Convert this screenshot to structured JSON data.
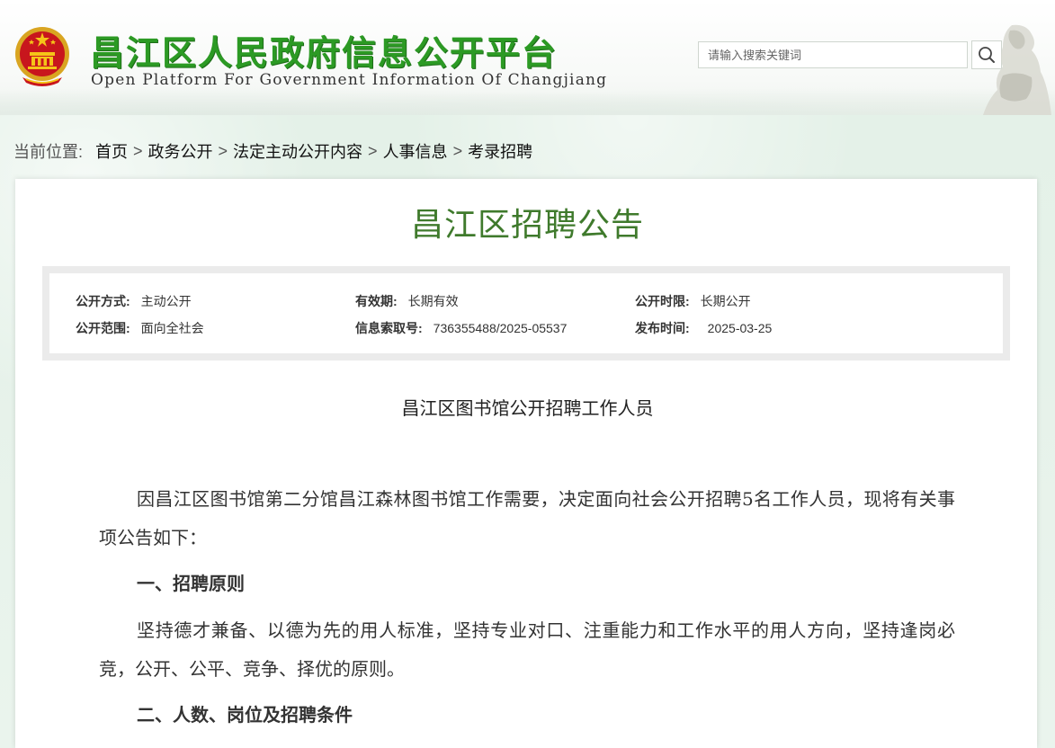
{
  "header": {
    "site_title": "昌江区人民政府信息公开平台",
    "site_subtitle": "Open Platform For Government Information Of Changjiang",
    "search": {
      "placeholder": "请输入搜索关键词"
    }
  },
  "breadcrumb": {
    "label": "当前位置:",
    "items": [
      "首页",
      "政务公开",
      "法定主动公开内容",
      "人事信息",
      "考录招聘"
    ],
    "separator": ">"
  },
  "article": {
    "title": "昌江区招聘公告",
    "meta": {
      "disclosure_method_label": "公开方式:",
      "disclosure_method": "主动公开",
      "validity_label": "有效期:",
      "validity": "长期有效",
      "disclosure_period_label": "公开时限:",
      "disclosure_period": "长期公开",
      "scope_label": "公开范围:",
      "scope": "面向全社会",
      "index_no_label": "信息索取号:",
      "index_no": "736355488/2025-05537",
      "publish_date_label": "发布时间:",
      "publish_date": "2025-03-25"
    },
    "subtitle": "昌江区图书馆公开招聘工作人员",
    "paragraph1": "因昌江区图书馆第二分馆昌江森林图书馆工作需要，决定面向社会公开招聘5名工作人员，现将有关事项公告如下：",
    "heading1": "一、招聘原则",
    "paragraph2": "坚持德才兼备、以德为先的用人标准，坚持专业对口、注重能力和工作水平的用人方向，坚持逢岗必竞，公开、公平、竞争、择优的原则。",
    "heading2": "二、人数、岗位及招聘条件"
  },
  "colors": {
    "title_green": "#2c9a24",
    "article_title_green": "#3f7a2c",
    "background": "#e9f3ec"
  },
  "icons": [
    "national-emblem-icon",
    "search-icon",
    "statue-decoration"
  ]
}
